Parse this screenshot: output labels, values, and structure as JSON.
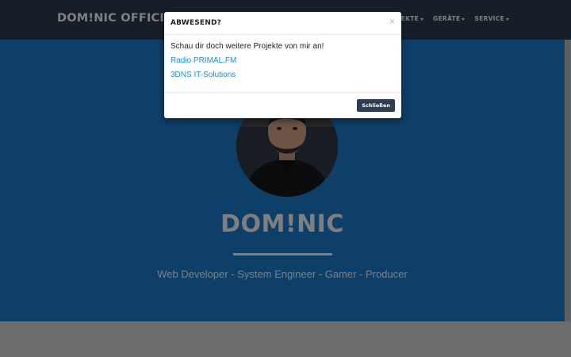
{
  "navbar": {
    "brand": "DOM!NIC OFFICIAL",
    "menu": [
      {
        "label": "PROJEKTE"
      },
      {
        "label": "GERÄTE"
      },
      {
        "label": "SERVICE"
      }
    ]
  },
  "hero": {
    "name": "DOM!NIC",
    "tagline": "Web Developer - System Engineer - Gamer - Producer"
  },
  "modal": {
    "title": "ABWESEND?",
    "close_symbol": "×",
    "text": "Schau dir doch weitere Projekte von mir an!",
    "links": [
      "Radio PRIMAL.FM",
      "3DNS IT-Solutions"
    ],
    "button_label": "Schließen"
  },
  "colors": {
    "navbar": "#2c3e50",
    "hero": "#1a7fd1",
    "link": "#1a8fd6",
    "button": "#2c3e50"
  }
}
